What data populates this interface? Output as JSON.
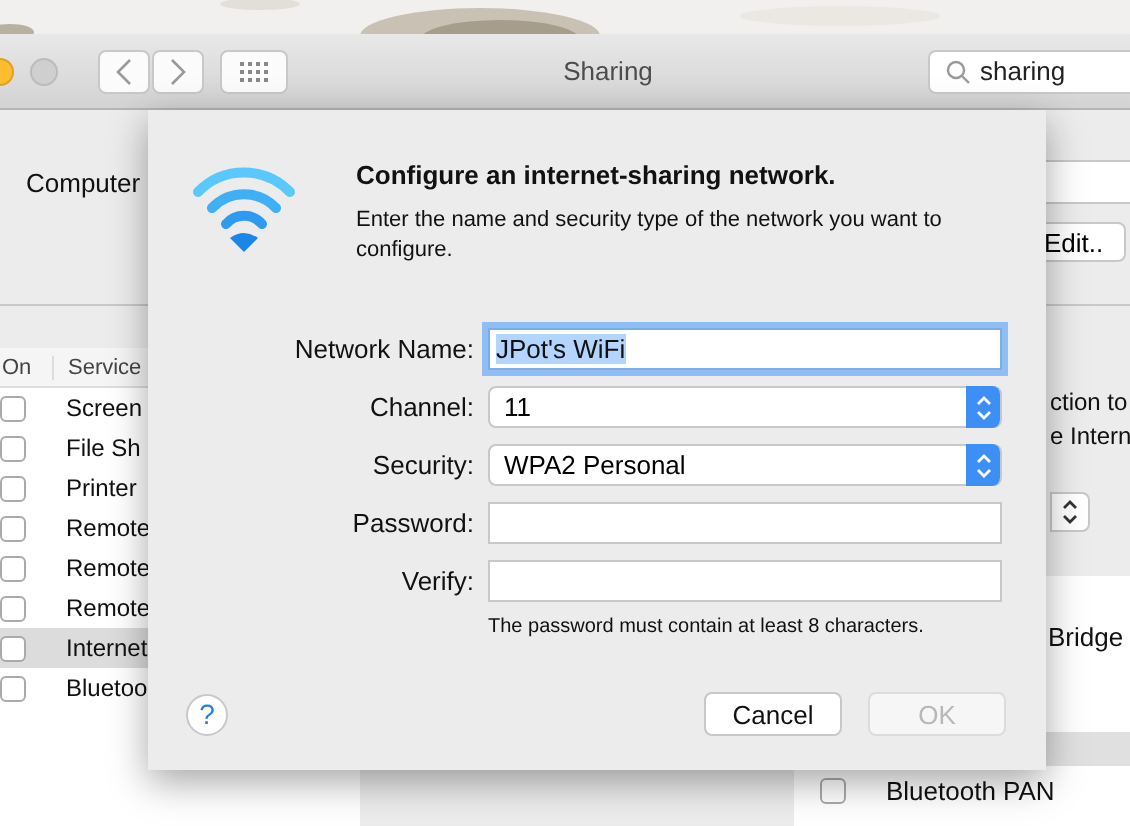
{
  "window": {
    "title": "Sharing",
    "search": {
      "value": "sharing"
    }
  },
  "computer_name": {
    "label": "Computer"
  },
  "edit_button": {
    "label": "Edit.."
  },
  "services": {
    "columns": [
      "On",
      "Service"
    ],
    "rows": [
      {
        "name": "Screen",
        "checked": false,
        "selected": false
      },
      {
        "name": "File Sh",
        "checked": false,
        "selected": false
      },
      {
        "name": "Printer",
        "checked": false,
        "selected": false
      },
      {
        "name": "Remote",
        "checked": false,
        "selected": false
      },
      {
        "name": "Remote",
        "checked": false,
        "selected": false
      },
      {
        "name": "Remote",
        "checked": false,
        "selected": false
      },
      {
        "name": "Internet",
        "checked": false,
        "selected": true
      },
      {
        "name": "Bluetoo",
        "checked": false,
        "selected": false
      }
    ]
  },
  "right_panel": {
    "lines": [
      "ction to",
      "e Intern"
    ],
    "list_items": [
      "Bridge"
    ],
    "ports": [
      {
        "name": "Bluetooth PAN",
        "checked": false
      }
    ]
  },
  "dialog": {
    "title": "Configure an internet-sharing network.",
    "description": "Enter the name and security type of the network you want to configure.",
    "fields": [
      {
        "kind": "text",
        "label": "Network Name:",
        "value": "JPot's WiFi",
        "focused": true
      },
      {
        "kind": "popup",
        "label": "Channel:",
        "value": "11"
      },
      {
        "kind": "popup",
        "label": "Security:",
        "value": "WPA2 Personal"
      },
      {
        "kind": "password",
        "label": "Password:"
      },
      {
        "kind": "password",
        "label": "Verify:"
      }
    ],
    "hint": "The password must contain at least 8 characters.",
    "help": "?",
    "buttons": [
      {
        "label": "Cancel",
        "disabled": false
      },
      {
        "label": "OK",
        "disabled": true
      }
    ]
  }
}
